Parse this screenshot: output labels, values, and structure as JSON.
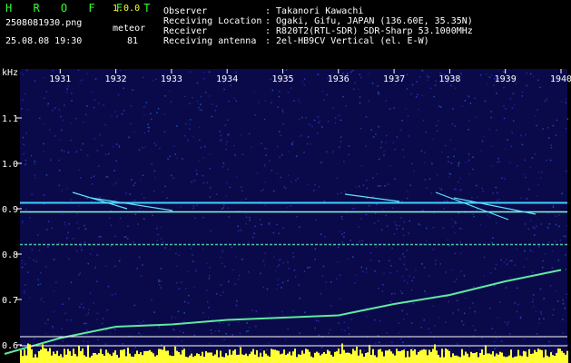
{
  "header": {
    "app_name": "H R O F F T",
    "version": "1.0.0",
    "filename": "2508081930.png",
    "datetime": "25.08.08 19:30",
    "meteor_label": "meteor",
    "meteor_count": "81",
    "info": [
      {
        "label": "Observer",
        "value": ": Takanori Kawachi"
      },
      {
        "label": "Receiving Location",
        "value": ": Ogaki, Gifu, JAPAN (136.60E, 35.35N)"
      },
      {
        "label": "Receiver",
        "value": ": R820T2(RTL-SDR) SDR-Sharp 53.1000MHz"
      },
      {
        "label": "Receiving antenna",
        "value": ": 2el-HB9CV Vertical (el. E-W)"
      }
    ]
  },
  "chart_data": {
    "type": "heatmap",
    "title": "",
    "xlabel": "",
    "ylabel": "kHz",
    "x_ticks": [
      "1931",
      "1932",
      "1933",
      "1934",
      "1935",
      "1936",
      "1937",
      "1938",
      "1939",
      "1940"
    ],
    "y_ticks": [
      "1.1",
      "1.0",
      "0.9",
      "0.8",
      "0.7",
      "0.6"
    ],
    "xlim": [
      "1930",
      "1940"
    ],
    "ylim": [
      0.58,
      1.18
    ],
    "grid": false,
    "colors": {
      "background": "#0a0a4a",
      "text": "#ffffff",
      "accent": "#ffff33",
      "logo": "#33ff33"
    },
    "horizontal_lines_khz": [
      0.913,
      0.893,
      0.821
    ],
    "drift_trace": [
      {
        "x": "1930",
        "y": 0.58
      },
      {
        "x": "1931",
        "y": 0.615
      },
      {
        "x": "1932",
        "y": 0.64
      },
      {
        "x": "1933",
        "y": 0.645
      },
      {
        "x": "1934",
        "y": 0.655
      },
      {
        "x": "1935",
        "y": 0.66
      },
      {
        "x": "1936",
        "y": 0.665
      },
      {
        "x": "1937",
        "y": 0.69
      },
      {
        "x": "1938",
        "y": 0.71
      },
      {
        "x": "1939",
        "y": 0.74
      },
      {
        "x": "1940",
        "y": 0.765
      }
    ]
  }
}
